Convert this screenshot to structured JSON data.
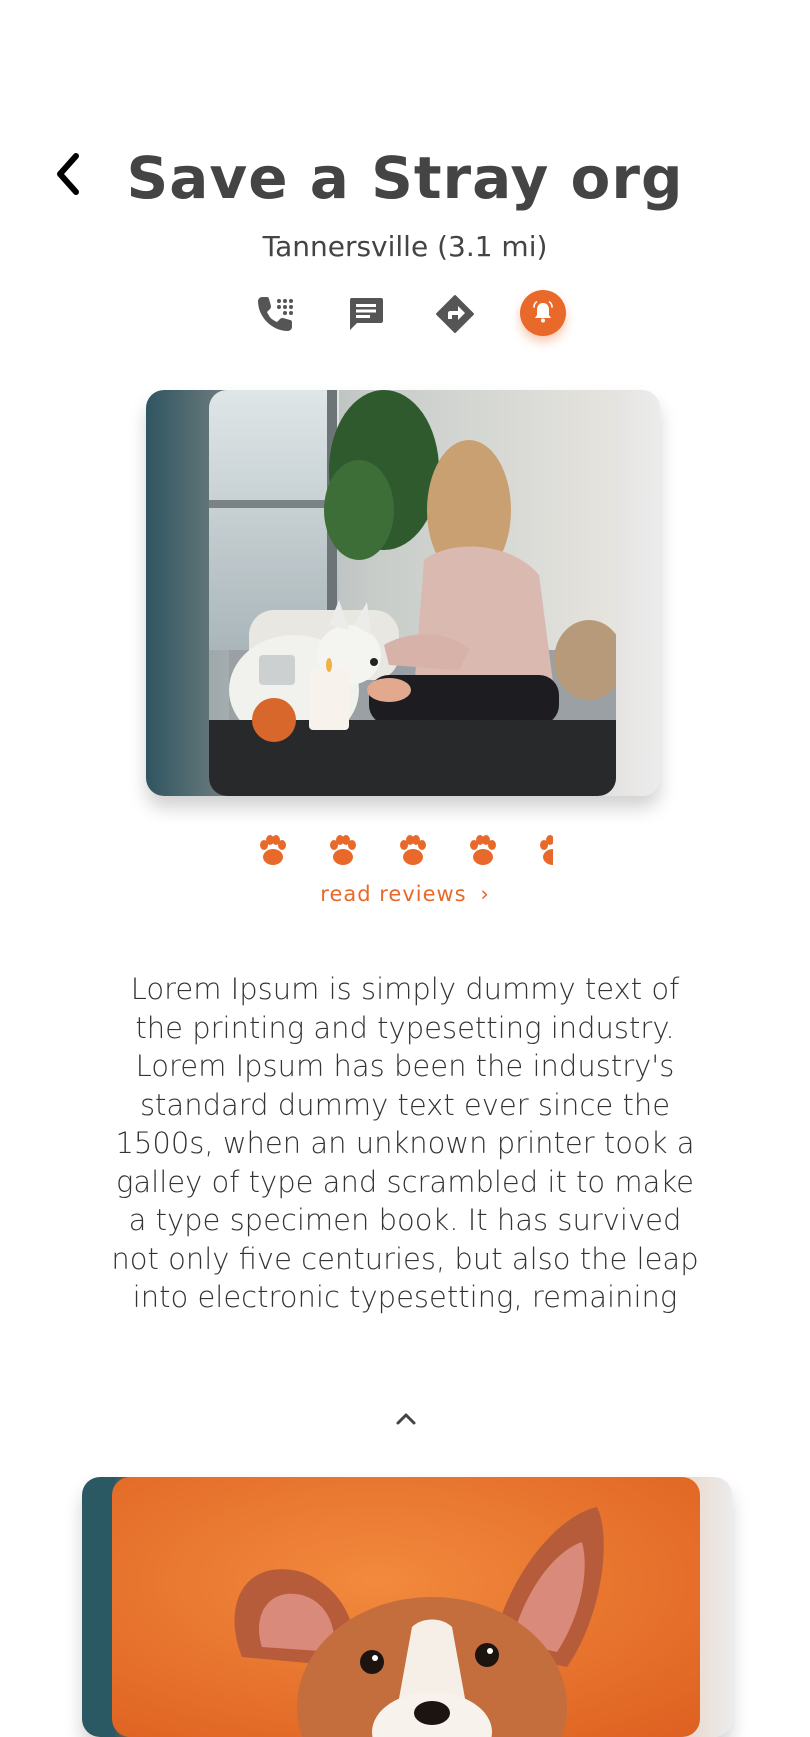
{
  "header": {
    "back_icon": "chevron-left-icon",
    "title": "Save a Stray org",
    "location": "Tannersville (3.1 mi)"
  },
  "actions": [
    {
      "name": "call-button",
      "icon": "phone-icon"
    },
    {
      "name": "message-button",
      "icon": "message-icon"
    },
    {
      "name": "directions-button",
      "icon": "directions-icon"
    },
    {
      "name": "alert-button",
      "icon": "bell-alert-icon"
    }
  ],
  "colors": {
    "accent": "#e8692a",
    "icon_gray": "#555555",
    "text": "#444444"
  },
  "rating": {
    "value": 4.5,
    "max": 5,
    "icon": "paw-icon"
  },
  "reviews": {
    "label": "read reviews",
    "chevron": "›"
  },
  "description": "Lorem Ipsum is simply dummy text of the printing and typesetting industry. Lorem Ipsum has been the industry's standard dummy text ever since the 1500s, when an unknown printer took a galley of type and scrambled it to make a type specimen book. It has survived not only five centuries, but also the leap into electronic typesetting, remaining",
  "collapse_icon": "chevron-up-icon"
}
